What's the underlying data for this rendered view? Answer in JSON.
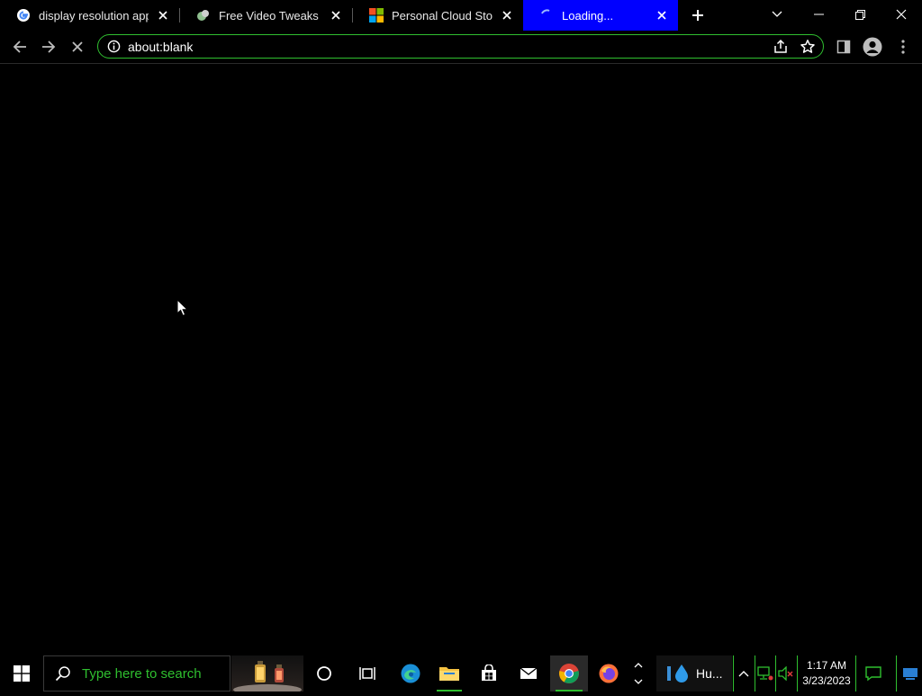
{
  "tabs": [
    {
      "title": "display resolution app -",
      "icon": "google-icon",
      "active": false
    },
    {
      "title": "Free Video Tweaks - Do",
      "icon": "video-tweaks-icon",
      "active": false
    },
    {
      "title": "Personal Cloud Storage",
      "icon": "microsoft-icon",
      "active": false
    },
    {
      "title": "Loading...",
      "icon": "loading-spinner-icon",
      "active": true
    }
  ],
  "address_bar": {
    "url": "about:blank"
  },
  "taskbar": {
    "search_placeholder": "Type here to search",
    "app_label": "Hu...",
    "clock_time": "1:17 AM",
    "clock_date": "3/23/2023"
  },
  "colors": {
    "accent": "#2fbf2f",
    "active_tab": "#0000ff",
    "background": "#000000"
  }
}
